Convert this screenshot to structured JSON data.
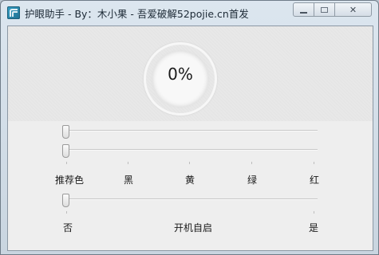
{
  "window": {
    "title": "护眼助手 - By：木小果 - 吾爱破解52pojie.cn首发",
    "icon": "app-icon",
    "buttons": {
      "minimize": "minimize-icon",
      "maximize": "maximize-icon",
      "close": "✕"
    }
  },
  "progress": {
    "label": "0%",
    "value": 0
  },
  "sliders": {
    "slider1": {
      "value": 0
    },
    "slider2": {
      "value": 0
    },
    "color_options": [
      "推荐色",
      "黑",
      "黄",
      "绿",
      "红"
    ],
    "autostart": {
      "value": 0,
      "left": "否",
      "center": "开机自启",
      "right": "是"
    }
  }
}
